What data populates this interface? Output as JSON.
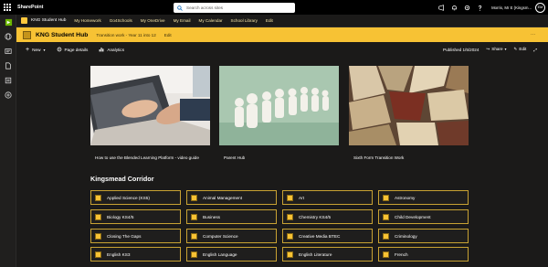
{
  "suite": {
    "app_name": "SharePoint",
    "search_placeholder": "Search across sites",
    "user_name": "Morris, Mr E (Kingsm...",
    "user_initials": "EM"
  },
  "hub": {
    "title": "KNG Student Hub",
    "links": [
      "My Homework",
      "Go4Schools",
      "My OneDrive",
      "My Email",
      "My Calendar",
      "School Library",
      "Edit"
    ]
  },
  "site": {
    "title": "KNG Student Hub",
    "links": [
      "Transition work - Year 11 into 12",
      "Edit"
    ],
    "more": "···"
  },
  "commands": {
    "new": "New",
    "page_details": "Page details",
    "analytics": "Analytics",
    "published": "Published 1/5/2024",
    "share": "Share",
    "edit": "Edit"
  },
  "cards": [
    {
      "title": "How to use the Blended Learning Platform - video guide"
    },
    {
      "title": "Parent Hub"
    },
    {
      "title": "Sixth Form Transition Work"
    }
  ],
  "corridor": {
    "title": "Kingsmead Corridor",
    "buttons": [
      "Applied Science (KS5)",
      "Animal Management",
      "Art",
      "Astronomy",
      "Biology KS4/5",
      "Business",
      "Chemistry KS4/5",
      "Child Development",
      "Closing The Gaps",
      "Computer Science",
      "Creative Media BTEC",
      "Criminology",
      "English KS3",
      "English Language",
      "English Literature",
      "French"
    ]
  },
  "colors": {
    "accent": "#f7c234",
    "background": "#1b1a19",
    "suitebar": "#000000",
    "button_border": "#c8a233"
  }
}
